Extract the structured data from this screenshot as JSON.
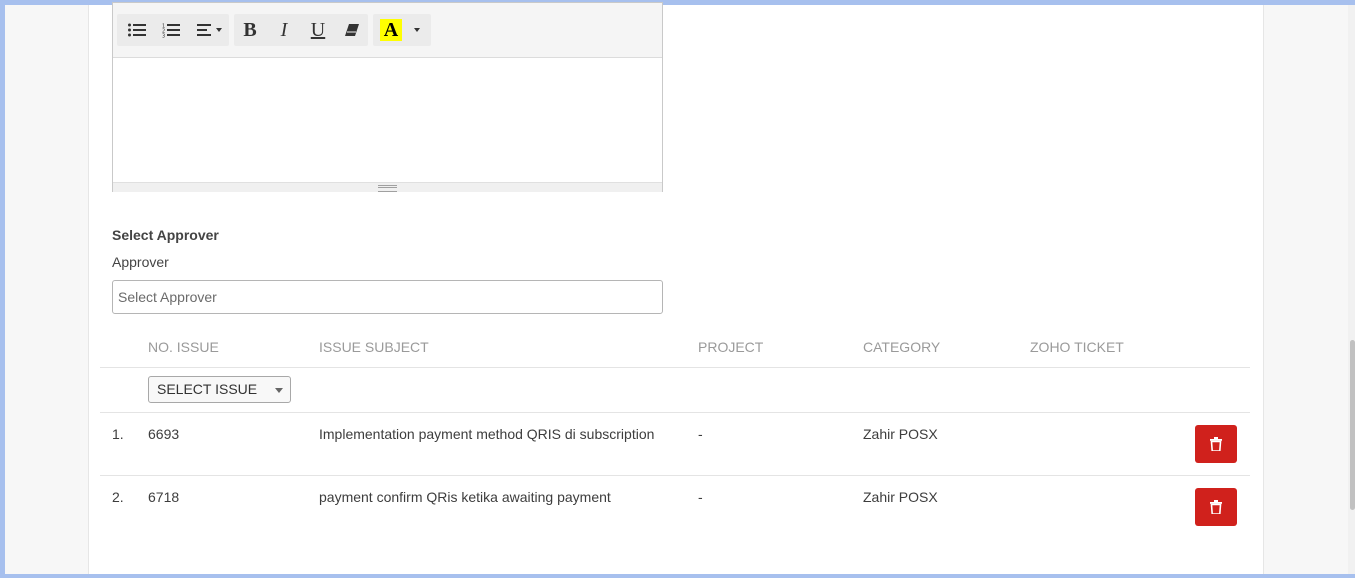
{
  "editor": {
    "toolbar": {
      "buttons": [
        {
          "name": "unordered-list",
          "icon": "list-ul-icon"
        },
        {
          "name": "ordered-list",
          "icon": "list-ol-icon"
        },
        {
          "name": "paragraph-align",
          "icon": "align-left-icon"
        },
        {
          "name": "bold",
          "label": "B"
        },
        {
          "name": "italic",
          "label": "I"
        },
        {
          "name": "underline",
          "label": "U"
        },
        {
          "name": "clear-format",
          "icon": "eraser-icon"
        },
        {
          "name": "highlight-color",
          "label": "A"
        }
      ]
    },
    "content": ""
  },
  "approver": {
    "section_title": "Select Approver",
    "label": "Approver",
    "placeholder": "Select Approver"
  },
  "issues_table": {
    "headers": [
      "NO. ISSUE",
      "ISSUE SUBJECT",
      "PROJECT",
      "CATEGORY",
      "ZOHO TICKET"
    ],
    "select_issue_label": "SELECT ISSUE",
    "rows": [
      {
        "index": "1.",
        "no": "6693",
        "subject": "Implementation payment method QRIS di subscription",
        "project": "-",
        "category": "Zahir POSX",
        "zoho": ""
      },
      {
        "index": "2.",
        "no": "6718",
        "subject": "payment confirm QRis ketika awaiting payment",
        "project": "-",
        "category": "Zahir POSX",
        "zoho": ""
      }
    ]
  },
  "colors": {
    "delete_button": "#d0211c",
    "frame": "#a7c0ee",
    "highlight": "#ffff00"
  }
}
